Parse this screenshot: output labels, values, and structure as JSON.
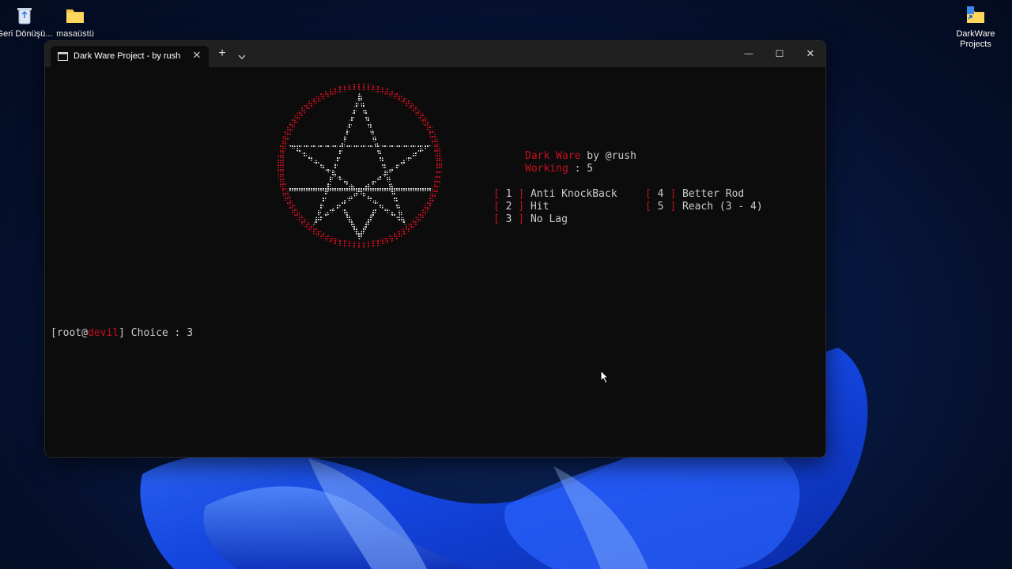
{
  "desktop": {
    "icons": [
      {
        "name": "recycle-bin",
        "label": "Geri Dönüşü..."
      },
      {
        "name": "masaustu-folder",
        "label": "masaüstü"
      },
      {
        "name": "darkware-projects",
        "label": "DarkWare Projects"
      }
    ]
  },
  "window": {
    "tab_title": "Dark Ware Project - by rush",
    "tab_close": "✕",
    "new_tab": "+",
    "dropdown": "⌄",
    "minimize": "—",
    "maximize": "☐",
    "close": "✕"
  },
  "terminal": {
    "header": {
      "name": "Dark Ware",
      "by": " by @rush",
      "working_label": "Working",
      "working_value": " : 5"
    },
    "menu": [
      {
        "num": "1",
        "label": "Anti KnockBack"
      },
      {
        "num": "2",
        "label": "Hit"
      },
      {
        "num": "3",
        "label": "No Lag"
      },
      {
        "num": "4",
        "label": "Better Rod"
      },
      {
        "num": "5",
        "label": "Reach (3 - 4)"
      }
    ],
    "prompt": {
      "open": "[root@",
      "host": "devil",
      "close": "] Choice : ",
      "value": "3"
    }
  },
  "colors": {
    "accent_red": "#c50f1f",
    "terminal_bg": "#0c0c0c",
    "terminal_fg": "#cccccc",
    "titlebar": "#202020"
  }
}
